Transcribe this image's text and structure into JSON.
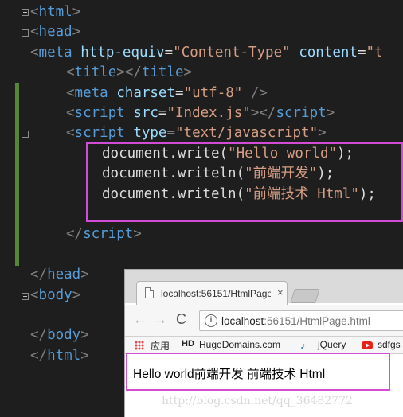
{
  "editor": {
    "lines": [
      {
        "tokens": [
          [
            "br",
            "<"
          ],
          [
            "t",
            "html"
          ],
          [
            "br",
            ">"
          ]
        ]
      },
      {
        "tokens": [
          [
            "br",
            "<"
          ],
          [
            "t",
            "head"
          ],
          [
            "br",
            ">"
          ]
        ]
      },
      {
        "tokens": [
          [
            "br",
            "<"
          ],
          [
            "t",
            "meta"
          ],
          [
            "pl",
            " "
          ],
          [
            "an",
            "http-equiv"
          ],
          [
            "pl",
            "="
          ],
          [
            "av",
            "\"Content-Type\""
          ],
          [
            "pl",
            " "
          ],
          [
            "an",
            "content"
          ],
          [
            "pl",
            "="
          ],
          [
            "av",
            "\"t"
          ]
        ]
      },
      {
        "tokens": [
          [
            "br",
            "<"
          ],
          [
            "t",
            "title"
          ],
          [
            "br",
            "></"
          ],
          [
            "t",
            "title"
          ],
          [
            "br",
            ">"
          ]
        ]
      },
      {
        "tokens": [
          [
            "br",
            "<"
          ],
          [
            "t",
            "meta"
          ],
          [
            "pl",
            " "
          ],
          [
            "an",
            "charset"
          ],
          [
            "pl",
            "="
          ],
          [
            "av",
            "\"utf-8\""
          ],
          [
            "pl",
            " "
          ],
          [
            "br",
            "/>"
          ]
        ]
      },
      {
        "tokens": [
          [
            "br",
            "<"
          ],
          [
            "t",
            "script"
          ],
          [
            "pl",
            " "
          ],
          [
            "an",
            "src"
          ],
          [
            "pl",
            "="
          ],
          [
            "av",
            "\"Index.js\""
          ],
          [
            "br",
            "></"
          ],
          [
            "t",
            "script"
          ],
          [
            "br",
            ">"
          ]
        ]
      },
      {
        "tokens": [
          [
            "br",
            "<"
          ],
          [
            "t",
            "script"
          ],
          [
            "pl",
            " "
          ],
          [
            "an",
            "type"
          ],
          [
            "pl",
            "="
          ],
          [
            "av",
            "\"text/javascript\""
          ],
          [
            "br",
            ">"
          ]
        ]
      },
      {
        "tokens": [
          [
            "js",
            "document.write("
          ],
          [
            "str",
            "\"Hello world\""
          ],
          [
            "js",
            ");"
          ]
        ]
      },
      {
        "tokens": [
          [
            "js",
            "document.writeln("
          ],
          [
            "str",
            "\"前端开发\""
          ],
          [
            "js",
            ");"
          ]
        ]
      },
      {
        "tokens": [
          [
            "js",
            "document.writeln("
          ],
          [
            "str",
            "\"前端技术 Html\""
          ],
          [
            "js",
            ");"
          ]
        ]
      },
      {
        "tokens": []
      },
      {
        "tokens": [
          [
            "br",
            "</"
          ],
          [
            "t",
            "script"
          ],
          [
            "br",
            ">"
          ]
        ]
      },
      {
        "tokens": []
      },
      {
        "tokens": [
          [
            "br",
            "</"
          ],
          [
            "t",
            "head"
          ],
          [
            "br",
            ">"
          ]
        ]
      },
      {
        "tokens": [
          [
            "br",
            "<"
          ],
          [
            "t",
            "body"
          ],
          [
            "br",
            ">"
          ]
        ]
      },
      {
        "tokens": []
      },
      {
        "tokens": [
          [
            "br",
            "</"
          ],
          [
            "t",
            "body"
          ],
          [
            "br",
            ">"
          ]
        ]
      },
      {
        "tokens": [
          [
            "br",
            "</"
          ],
          [
            "t",
            "html"
          ],
          [
            "br",
            ">"
          ]
        ]
      }
    ]
  },
  "browser": {
    "tab_title": "localhost:56151/HtmlPage",
    "tab_close": "×",
    "nav_back": "←",
    "nav_forward": "→",
    "nav_reload": "C",
    "info_icon": "i",
    "url_host": "localhost",
    "url_rest": ":56151/HtmlPage.html",
    "bookmarks": {
      "apps": "应用",
      "hd_badge": "HD",
      "hugedomains": "HugeDomains.com",
      "jquery_glyph": "♪",
      "jquery": "jQuery",
      "sdfgs": "sdfgs"
    },
    "output_text": "Hello world前端开发 前端技术 Html",
    "watermark": "http://blog.csdn.net/qq_36482772"
  },
  "colors": {
    "editor_bg": "#1e1e1e",
    "tag": "#569cd6",
    "attr_name": "#9cdcfe",
    "attr_value": "#d69d85",
    "highlight_box": "#d24cd6",
    "changed_bar": "#57863a"
  }
}
